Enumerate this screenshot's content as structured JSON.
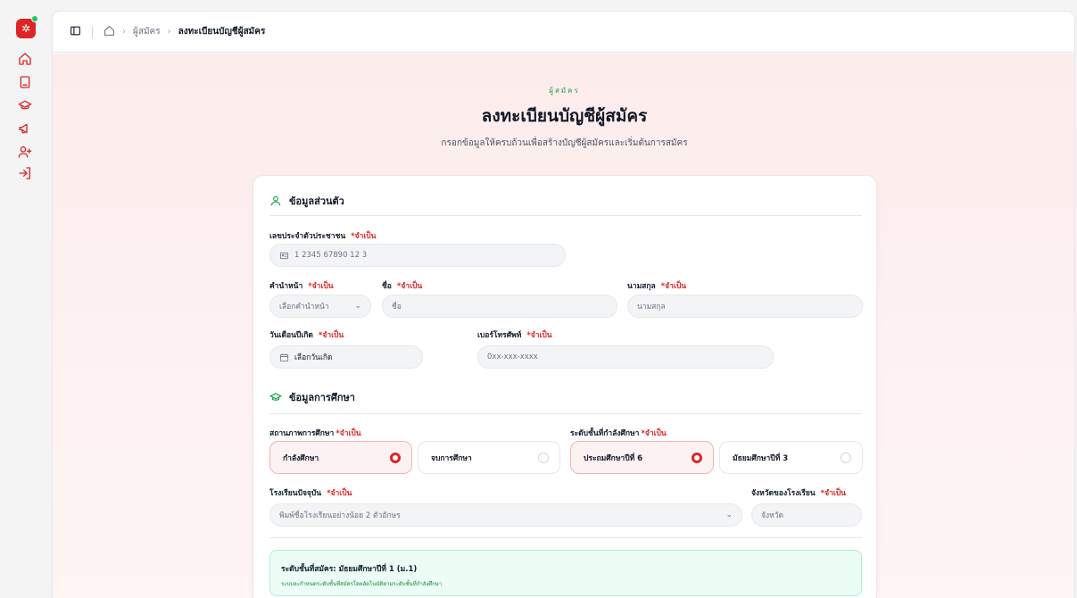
{
  "rail": {
    "items": [
      "home-icon",
      "tablet-icon",
      "graduation-cap-icon",
      "megaphone-icon",
      "user-plus-icon",
      "login-icon"
    ]
  },
  "breadcrumb": {
    "applicants": "ผู้สมัคร",
    "current": "ลงทะเบียนบัญชีผู้สมัคร"
  },
  "header": {
    "eyebrow": "ผู้สมัคร",
    "title": "ลงทะเบียนบัญชีผู้สมัคร",
    "subtitle": "กรอกข้อมูลให้ครบถ้วนเพื่อสร้างบัญชีผู้สมัครและเริ่มต้นการสมัคร"
  },
  "personal": {
    "heading": "ข้อมูลส่วนตัว",
    "required": "*จำเป็น",
    "id_label": "เลขประจำตัวประชาชน",
    "id_placeholder": "1 2345 67890 12 3",
    "prefix_label": "คำนำหน้า",
    "prefix_placeholder": "เลือกคำนำหน้า",
    "first_label": "ชื่อ",
    "first_placeholder": "ชื่อ",
    "last_label": "นามสกุล",
    "last_placeholder": "นามสกุล",
    "dob_label": "วันเดือนปีเกิด",
    "dob_value": "เลือกวันเกิด",
    "phone_label": "เบอร์โทรศัพท์",
    "phone_placeholder": "0xx-xxx-xxxx"
  },
  "education": {
    "heading": "ข้อมูลการศึกษา",
    "status_label": "สถานภาพการศึกษา",
    "status_options": [
      {
        "label": "กำลังศึกษา",
        "selected": true
      },
      {
        "label": "จบการศึกษา",
        "selected": false
      }
    ],
    "level_label": "ระดับชั้นที่กำลังศึกษา",
    "level_options": [
      {
        "label": "ประถมศึกษาปีที่ 6",
        "selected": true
      },
      {
        "label": "มัธยมศึกษาปีที่ 3",
        "selected": false
      }
    ],
    "school_label": "โรงเรียนปัจจุบัน",
    "school_placeholder": "พิมพ์ชื่อโรงเรียนอย่างน้อย 2 ตัวอักษร",
    "province_label": "จังหวัดของโรงเรียน",
    "province_placeholder": "จังหวัด"
  },
  "notice": {
    "title": "ระดับชั้นที่สมัคร: มัธยมศึกษาปีที่ 1 (ม.1)",
    "desc": "ระบบจะกำหนดระดับชั้นที่สมัครโดยอัตโนมัติตามระดับชั้นที่กำลังศึกษา"
  },
  "colors": {
    "accent": "#dc2626",
    "success": "#16a34a"
  }
}
